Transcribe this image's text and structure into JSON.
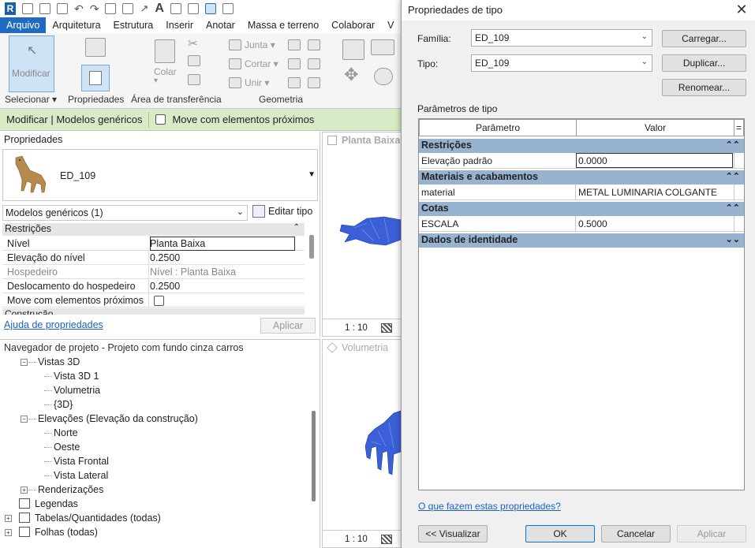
{
  "ribbon": {
    "tabs": [
      "Arquivo",
      "Arquitetura",
      "Estrutura",
      "Inserir",
      "Anotar",
      "Massa e terreno",
      "Colaborar",
      "V"
    ],
    "modify_label": "Modificar",
    "panel_selecionar": "Selecionar",
    "panel_propriedades": "Propriedades",
    "panel_transferencia": "Área de transferência",
    "panel_geometria": "Geometria",
    "colar": "Colar",
    "junta": "Junta",
    "cortar": "Cortar",
    "unir": "Unir",
    "qa_a": "A"
  },
  "context": {
    "mode": "Modificar | Modelos genéricos",
    "move_label": "Move com elementos próximos"
  },
  "properties": {
    "title": "Propriedades",
    "type_name": "ED_109",
    "selector": "Modelos genéricos (1)",
    "edit_type": "Editar tipo",
    "section_restricoes": "Restrições",
    "rows": [
      {
        "key": "Nível",
        "value": "Planta Baixa"
      },
      {
        "key": "Elevação do nível",
        "value": "0.2500"
      },
      {
        "key": "Hospedeiro",
        "value": "Nível : Planta Baixa"
      },
      {
        "key": "Deslocamento do hospedeiro",
        "value": "0.2500"
      },
      {
        "key": "Move com elementos próximos",
        "value": ""
      }
    ],
    "section_construcao": "Construção",
    "help": "Ajuda de propriedades",
    "apply": "Aplicar"
  },
  "navigator": {
    "title": "Navegador de projeto - Projeto com fundo cinza carros",
    "items": [
      "Vistas 3D",
      "Vista 3D 1",
      "Volumetria",
      "{3D}",
      "Elevações (Elevação da construção)",
      "Norte",
      "Oeste",
      "Vista Frontal",
      "Vista Lateral",
      "Renderizações",
      "Legendas",
      "Tabelas/Quantidades (todas)",
      "Folhas (todas)"
    ]
  },
  "views": {
    "plan_title": "Planta Baixa",
    "plan_scale": "1 : 10",
    "vol_title": "Volumetria",
    "vol_scale": "1 : 10"
  },
  "dialog": {
    "title": "Propriedades de tipo",
    "familia_label": "Família:",
    "familia_value": "ED_109",
    "tipo_label": "Tipo:",
    "tipo_value": "ED_109",
    "btn_carregar": "Carregar...",
    "btn_duplicar": "Duplicar...",
    "btn_renomear": "Renomear...",
    "params_label": "Parâmetros de tipo",
    "col_param": "Parâmetro",
    "col_valor": "Valor",
    "col_eq": "=",
    "sections": [
      {
        "name": "Restrições",
        "rows": [
          {
            "key": "Elevação padrão",
            "value": "0.0000"
          }
        ]
      },
      {
        "name": "Materiais e acabamentos",
        "rows": [
          {
            "key": "material",
            "value": "METAL LUMINARIA COLGANTE"
          }
        ]
      },
      {
        "name": "Cotas",
        "rows": [
          {
            "key": "ESCALA",
            "value": "0.5000"
          }
        ]
      },
      {
        "name": "Dados de identidade",
        "rows": []
      }
    ],
    "help_link": "O que fazem estas propriedades?",
    "btn_preview": "<< Visualizar",
    "btn_ok": "OK",
    "btn_cancel": "Cancelar",
    "btn_apply": "Aplicar"
  }
}
